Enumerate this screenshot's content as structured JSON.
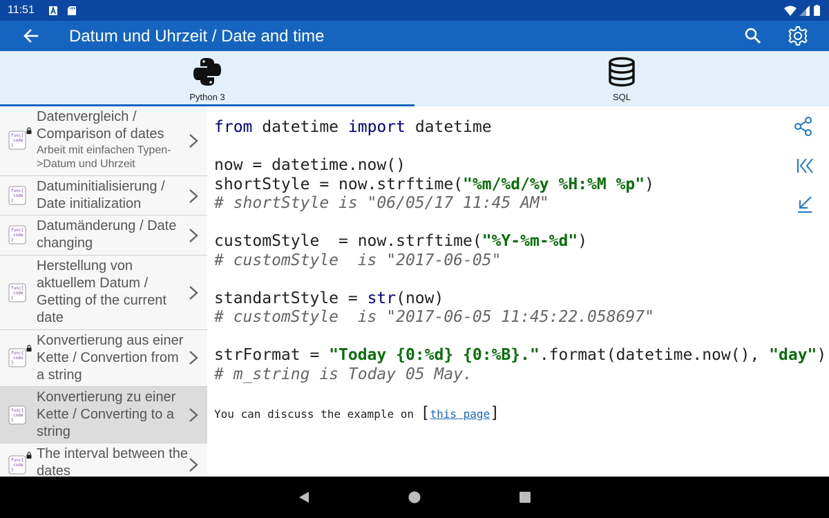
{
  "status": {
    "time": "11:51"
  },
  "appbar": {
    "title": "Datum und Uhrzeit / Date and time"
  },
  "tabs": [
    {
      "label": "Python 3",
      "icon": "python-icon",
      "selected": true
    },
    {
      "label": "SQL",
      "icon": "database-icon",
      "selected": false
    }
  ],
  "sidebar": {
    "items": [
      {
        "title": "Datenvergleich / Comparison of dates",
        "subtitle": "Arbeit mit einfachen Typen->Datum und Uhrzeit",
        "locked": true
      },
      {
        "title": "Datuminitialisierung / Date initialization",
        "locked": false
      },
      {
        "title": "Datumänderung / Date changing",
        "locked": false
      },
      {
        "title": "Herstellung von aktuellem Datum / Getting of the current date",
        "locked": false
      },
      {
        "title": "Konvertierung aus einer Kette / Convertion from a string",
        "locked": true
      },
      {
        "title": "Konvertierung zu einer Kette / Converting to a string",
        "locked": false,
        "selected": true
      },
      {
        "title": "The interval between the dates",
        "locked": true
      }
    ]
  },
  "code": {
    "line1": {
      "kw1": "from",
      "t1": " datetime ",
      "kw2": "import",
      "t2": " datetime"
    },
    "line3": "now = datetime.now()",
    "line4": {
      "t1": "shortStyle = now.strftime(",
      "s1": "\"%m/%d/%y %H:%M %p\"",
      "t2": ")"
    },
    "line5": "# shortStyle is \"06/05/17 11:45 AM\"",
    "line7": {
      "t1": "customStyle  = now.strftime(",
      "s1": "\"%Y-%m-%d\"",
      "t2": ")"
    },
    "line8": "# customStyle  is \"2017-06-05\"",
    "line10": {
      "t1": "standartStyle = ",
      "b1": "str",
      "t2": "(now)"
    },
    "line11": "# customStyle  is \"2017-06-05 11:45:22.058697\"",
    "line13": {
      "t1": "strFormat = ",
      "s1": "\"Today {0:%d} {0:%B}.\"",
      "t2": ".format(datetime.now(), ",
      "s2": "\"day\"",
      "t3": ")"
    },
    "line14": "# m_string is Today 05 May."
  },
  "discussion": {
    "prefix": "You can discuss the example on ",
    "open_bracket": "[",
    "link": "this page",
    "close_bracket": "]"
  },
  "colors": {
    "appbar": "#1565c0",
    "statusbar": "#0c47a1",
    "keyword": "#000080",
    "string": "#0a6e0a",
    "comment": "#666666"
  }
}
